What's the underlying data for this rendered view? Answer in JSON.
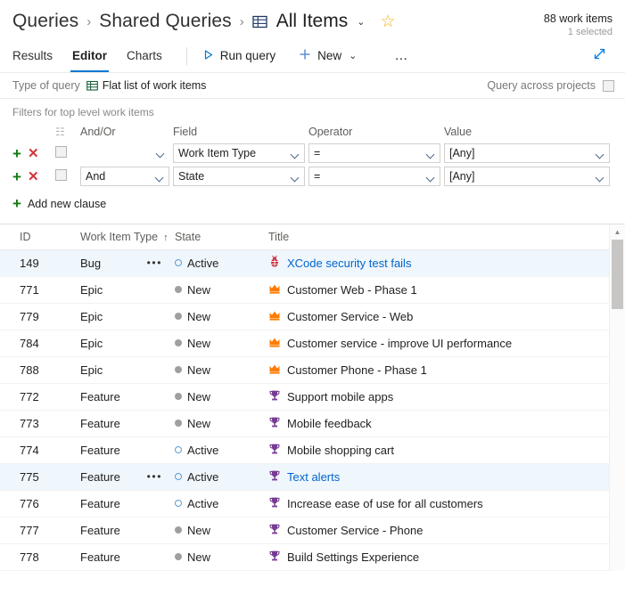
{
  "header": {
    "breadcrumb": [
      {
        "label": "Queries",
        "type": "link"
      },
      {
        "label": "Shared Queries",
        "type": "link"
      },
      {
        "label": "All Items",
        "type": "current"
      }
    ],
    "separator": "›",
    "chevron": "⌄",
    "star_icon": "☆",
    "grid_icon": "grid-icon",
    "count": "88 work items",
    "selected": "1 selected"
  },
  "toolbar": {
    "tabs": [
      {
        "label": "Results",
        "active": false
      },
      {
        "label": "Editor",
        "active": true
      },
      {
        "label": "Charts",
        "active": false
      }
    ],
    "run_query": "Run query",
    "new": "New",
    "new_chevron": "⌄",
    "ellipsis": "…",
    "run_icon": "play-triangle-icon",
    "new_icon": "plus-icon",
    "expand_icon": "expand-diagonal-icon"
  },
  "query_type": {
    "label": "Type of query",
    "value": "Flat list of work items",
    "icon": "grid-icon",
    "across_projects_label": "Query across projects",
    "across_projects_checked": false
  },
  "filters": {
    "title": "Filters for top level work items",
    "columns": [
      "And/Or",
      "Field",
      "Operator",
      "Value"
    ],
    "group_icon": "group-clause-icon",
    "add_icon": "+",
    "delete_icon": "✕",
    "add_clause_label": "Add new clause",
    "rows": [
      {
        "andor": "",
        "field": "Work Item Type",
        "operator": "=",
        "value": "[Any]",
        "checked": false
      },
      {
        "andor": "And",
        "field": "State",
        "operator": "=",
        "value": "[Any]",
        "checked": false
      }
    ]
  },
  "results": {
    "columns": [
      "ID",
      "Work Item Type",
      "State",
      "Title"
    ],
    "sort_column": "Work Item Type",
    "sort_icon": "↑",
    "context_menu_icon": "•••",
    "rows": [
      {
        "id": "149",
        "type": "Bug",
        "state": "Active",
        "title": "XCode security test fails",
        "icon": "bug-icon",
        "selected": true,
        "menu": true
      },
      {
        "id": "771",
        "type": "Epic",
        "state": "New",
        "title": "Customer Web - Phase 1",
        "icon": "epic-crown-icon",
        "selected": false,
        "menu": false
      },
      {
        "id": "779",
        "type": "Epic",
        "state": "New",
        "title": "Customer Service - Web",
        "icon": "epic-crown-icon",
        "selected": false,
        "menu": false
      },
      {
        "id": "784",
        "type": "Epic",
        "state": "New",
        "title": "Customer service - improve UI performance",
        "icon": "epic-crown-icon",
        "selected": false,
        "menu": false
      },
      {
        "id": "788",
        "type": "Epic",
        "state": "New",
        "title": "Customer Phone - Phase 1",
        "icon": "epic-crown-icon",
        "selected": false,
        "menu": false
      },
      {
        "id": "772",
        "type": "Feature",
        "state": "New",
        "title": "Support mobile apps",
        "icon": "feature-trophy-icon",
        "selected": false,
        "menu": false
      },
      {
        "id": "773",
        "type": "Feature",
        "state": "New",
        "title": "Mobile feedback",
        "icon": "feature-trophy-icon",
        "selected": false,
        "menu": false
      },
      {
        "id": "774",
        "type": "Feature",
        "state": "Active",
        "title": "Mobile shopping cart",
        "icon": "feature-trophy-icon",
        "selected": false,
        "menu": false
      },
      {
        "id": "775",
        "type": "Feature",
        "state": "Active",
        "title": "Text alerts",
        "icon": "feature-trophy-icon",
        "selected": true,
        "menu": true
      },
      {
        "id": "776",
        "type": "Feature",
        "state": "Active",
        "title": "Increase ease of use for all customers",
        "icon": "feature-trophy-icon",
        "selected": false,
        "menu": false
      },
      {
        "id": "777",
        "type": "Feature",
        "state": "New",
        "title": "Customer Service - Phone",
        "icon": "feature-trophy-icon",
        "selected": false,
        "menu": false
      },
      {
        "id": "778",
        "type": "Feature",
        "state": "New",
        "title": "Build Settings Experience",
        "icon": "feature-trophy-icon",
        "selected": false,
        "menu": false
      }
    ]
  },
  "colors": {
    "accent": "#0078d4",
    "bug": "#cc293d",
    "epic": "#ff7b00",
    "feature": "#773b93",
    "add_green": "#107c10",
    "delete_red": "#d13438",
    "star": "#f2b51c",
    "selected_row": "#eff6fc"
  }
}
